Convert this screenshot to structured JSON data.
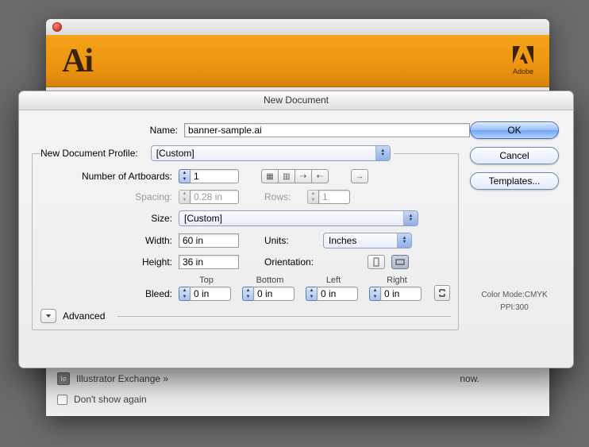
{
  "ai_window": {
    "logo": "Ai",
    "brand": "Adobe",
    "illustrator_exchange": "Illustrator Exchange »",
    "now": "now.",
    "dont_show": "Don't show again"
  },
  "dialog": {
    "title": "New Document",
    "name_label": "Name:",
    "name_value": "banner-sample.ai",
    "profile_legend": "New Document Profile:",
    "profile_value": "[Custom]",
    "artboards_label": "Number of Artboards:",
    "artboards_value": "1",
    "spacing_label": "Spacing:",
    "spacing_value": "0.28 in",
    "rows_label": "Rows:",
    "rows_value": "1",
    "size_label": "Size:",
    "size_value": "[Custom]",
    "width_label": "Width:",
    "width_value": "60 in",
    "height_label": "Height:",
    "height_value": "36 in",
    "units_label": "Units:",
    "units_value": "Inches",
    "orientation_label": "Orientation:",
    "bleed_label": "Bleed:",
    "bleed": {
      "top_label": "Top",
      "bottom_label": "Bottom",
      "left_label": "Left",
      "right_label": "Right",
      "top": "0 in",
      "bottom": "0 in",
      "left": "0 in",
      "right": "0 in"
    },
    "advanced": "Advanced",
    "ok": "OK",
    "cancel": "Cancel",
    "templates": "Templates...",
    "color_mode": "Color Mode:CMYK",
    "ppi": "PPI:300"
  }
}
